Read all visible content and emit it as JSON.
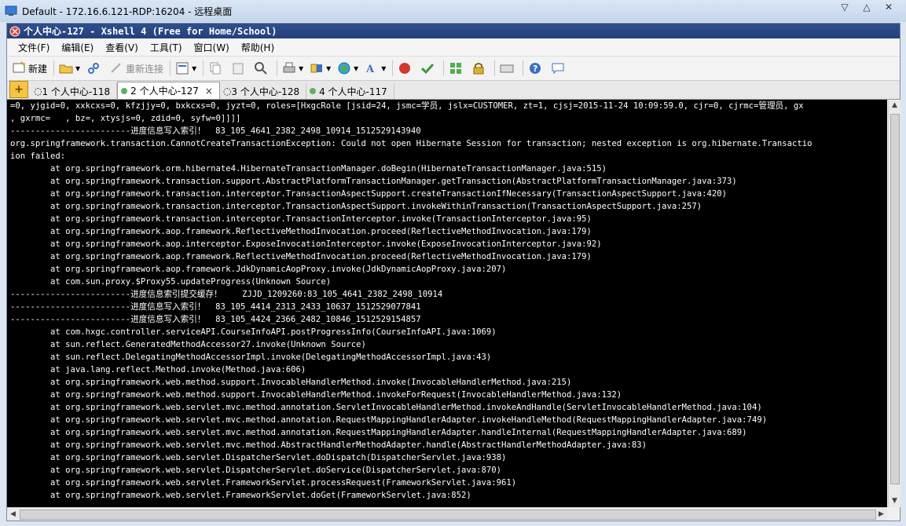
{
  "window": {
    "outer_title": "Default - 172.16.6.121-RDP:16204 - 远程桌面",
    "inner_title": "个人中心-127 - Xshell 4 (Free for Home/School)"
  },
  "menu": [
    "文件(F)",
    "编辑(E)",
    "查看(V)",
    "工具(T)",
    "窗口(W)",
    "帮助(H)"
  ],
  "toolbar": {
    "new_label": "新建",
    "reconnect_label": "重新连接"
  },
  "tabs": [
    {
      "label": "1 个人中心-118"
    },
    {
      "label": "2 个人中心-127",
      "close": "×"
    },
    {
      "label": "3 个人中心-128"
    },
    {
      "label": "4 个人中心-117"
    }
  ],
  "tab_plus": "+",
  "terminal_lines": [
    "=0, yjgid=0, xxkcxs=0, kfzjjy=0, bxkcxs=0, jyzt=0, roles=[HxgcRole [jsid=24, jsmc=学员, jslx=CUSTOMER, zt=1, cjsj=2015-11-24 10:09:59.0, cjr=0, cjrmc=管理员, gx",
    ", gxrmc=   , bz=, xtysjs=0, zdid=0, syfw=0]]]]",
    "------------------------进度信息写入索引！  83_105_4641_2382_2498_10914_1512529143940",
    "org.springframework.transaction.CannotCreateTransactionException: Could not open Hibernate Session for transaction; nested exception is org.hibernate.Transactio",
    "ion failed:",
    "        at org.springframework.orm.hibernate4.HibernateTransactionManager.doBegin(HibernateTransactionManager.java:515)",
    "        at org.springframework.transaction.support.AbstractPlatformTransactionManager.getTransaction(AbstractPlatformTransactionManager.java:373)",
    "        at org.springframework.transaction.interceptor.TransactionAspectSupport.createTransactionIfNecessary(TransactionAspectSupport.java:420)",
    "        at org.springframework.transaction.interceptor.TransactionAspectSupport.invokeWithinTransaction(TransactionAspectSupport.java:257)",
    "        at org.springframework.transaction.interceptor.TransactionInterceptor.invoke(TransactionInterceptor.java:95)",
    "        at org.springframework.aop.framework.ReflectiveMethodInvocation.proceed(ReflectiveMethodInvocation.java:179)",
    "        at org.springframework.aop.interceptor.ExposeInvocationInterceptor.invoke(ExposeInvocationInterceptor.java:92)",
    "        at org.springframework.aop.framework.ReflectiveMethodInvocation.proceed(ReflectiveMethodInvocation.java:179)",
    "        at org.springframework.aop.framework.JdkDynamicAopProxy.invoke(JdkDynamicAopProxy.java:207)",
    "        at com.sun.proxy.$Proxy55.updateProgress(Unknown Source)",
    "------------------------进度信息索引提交缓存！    ZJJD_1209260:83_105_4641_2382_2498_10914",
    "------------------------进度信息写入索引！  83_105_4414_2313_2433_10637_1512529077841",
    "------------------------进度信息写入索引！  83_105_4424_2366_2482_10846_1512529154857",
    "        at com.hxgc.controller.serviceAPI.CourseInfoAPI.postProgressInfo(CourseInfoAPI.java:1069)",
    "        at sun.reflect.GeneratedMethodAccessor27.invoke(Unknown Source)",
    "        at sun.reflect.DelegatingMethodAccessorImpl.invoke(DelegatingMethodAccessorImpl.java:43)",
    "        at java.lang.reflect.Method.invoke(Method.java:606)",
    "        at org.springframework.web.method.support.InvocableHandlerMethod.invoke(InvocableHandlerMethod.java:215)",
    "        at org.springframework.web.method.support.InvocableHandlerMethod.invokeForRequest(InvocableHandlerMethod.java:132)",
    "        at org.springframework.web.servlet.mvc.method.annotation.ServletInvocableHandlerMethod.invokeAndHandle(ServletInvocableHandlerMethod.java:104)",
    "        at org.springframework.web.servlet.mvc.method.annotation.RequestMappingHandlerAdapter.invokeHandleMethod(RequestMappingHandlerAdapter.java:749)",
    "        at org.springframework.web.servlet.mvc.method.annotation.RequestMappingHandlerAdapter.handleInternal(RequestMappingHandlerAdapter.java:689)",
    "        at org.springframework.web.servlet.mvc.method.AbstractHandlerMethodAdapter.handle(AbstractHandlerMethodAdapter.java:83)",
    "        at org.springframework.web.servlet.DispatcherServlet.doDispatch(DispatcherServlet.java:938)",
    "        at org.springframework.web.servlet.DispatcherServlet.doService(DispatcherServlet.java:870)",
    "        at org.springframework.web.servlet.FrameworkServlet.processRequest(FrameworkServlet.java:961)",
    "        at org.springframework.web.servlet.FrameworkServlet.doGet(FrameworkServlet.java:852)"
  ],
  "icons": {
    "outer_app": "remote-desktop-icon",
    "xshell": "xshell-icon"
  }
}
